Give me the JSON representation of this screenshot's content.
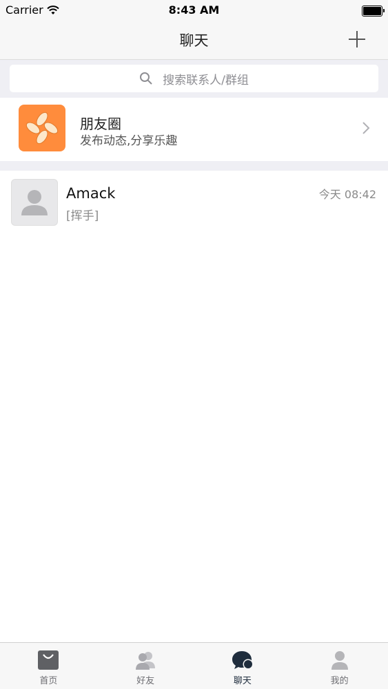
{
  "status_bar": {
    "carrier": "Carrier",
    "time": "8:43 AM"
  },
  "nav": {
    "title": "聊天",
    "add_icon": "plus-icon"
  },
  "search": {
    "placeholder": "搜索联系人/群组",
    "icon": "search-icon"
  },
  "moments": {
    "title": "朋友圈",
    "subtitle": "发布动态,分享乐趣",
    "icon_color": "#ff8c3c",
    "icon": "pinwheel-icon"
  },
  "chats": [
    {
      "name": "Amack",
      "preview": "[挥手]",
      "time": "今天 08:42",
      "avatar": "default-person-avatar"
    }
  ],
  "tabs": [
    {
      "label": "首页",
      "icon": "shopping-bag-icon",
      "active": false
    },
    {
      "label": "好友",
      "icon": "friends-icon",
      "active": false
    },
    {
      "label": "聊天",
      "icon": "chat-bubble-icon",
      "active": true
    },
    {
      "label": "我的",
      "icon": "profile-icon",
      "active": false
    }
  ],
  "colors": {
    "accent_dark": "#1f2d3d",
    "moments_orange": "#ff8c3c",
    "background_gray": "#efeff4"
  }
}
